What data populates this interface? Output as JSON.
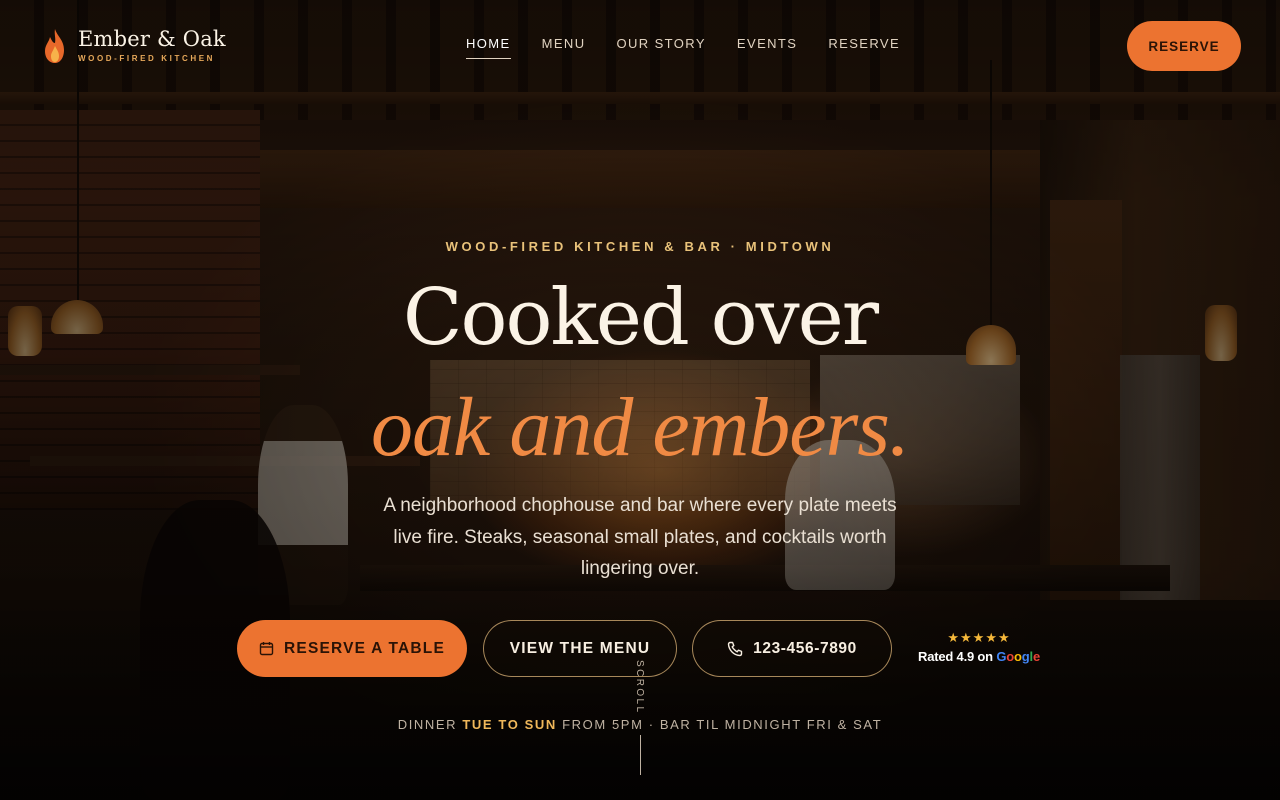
{
  "colors": {
    "accent": "#ec7330",
    "accent_italic": "#f08a44",
    "gold": "#e9c27a",
    "stars": "#f5b83a"
  },
  "brand": {
    "name": "Ember & Oak",
    "tagline": "WOOD-FIRED KITCHEN",
    "logo_icon": "flame-icon"
  },
  "nav": {
    "items": [
      {
        "label": "HOME",
        "active": true
      },
      {
        "label": "MENU",
        "active": false
      },
      {
        "label": "OUR STORY",
        "active": false
      },
      {
        "label": "EVENTS",
        "active": false
      },
      {
        "label": "RESERVE",
        "active": false
      }
    ],
    "cta_label": "RESERVE"
  },
  "hero": {
    "eyebrow": "WOOD-FIRED KITCHEN & BAR · MIDTOWN",
    "title_line1": "Cooked over",
    "title_line2": "oak and embers.",
    "lede": "A neighborhood chophouse and bar where every plate meets live fire. Steaks, seasonal small plates, and cocktails worth lingering over.",
    "buttons": {
      "reserve": {
        "label": "RESERVE A TABLE",
        "icon": "calendar-icon"
      },
      "menu": {
        "label": "VIEW THE MENU"
      },
      "phone": {
        "label": "123-456-7890",
        "icon": "phone-icon"
      }
    },
    "rating": {
      "stars": "★★★★★",
      "prefix": "Rated 4.9 on",
      "provider": "Google",
      "provider_colors": [
        "#4285F4",
        "#EA4335",
        "#FBBC05",
        "#4285F4",
        "#34A853",
        "#EA4335"
      ]
    },
    "hours": {
      "part1": "DINNER",
      "days": "TUE TO SUN",
      "part2": "FROM 5PM · BAR TIL MIDNIGHT FRI & SAT"
    },
    "scroll_label": "SCROLL"
  }
}
